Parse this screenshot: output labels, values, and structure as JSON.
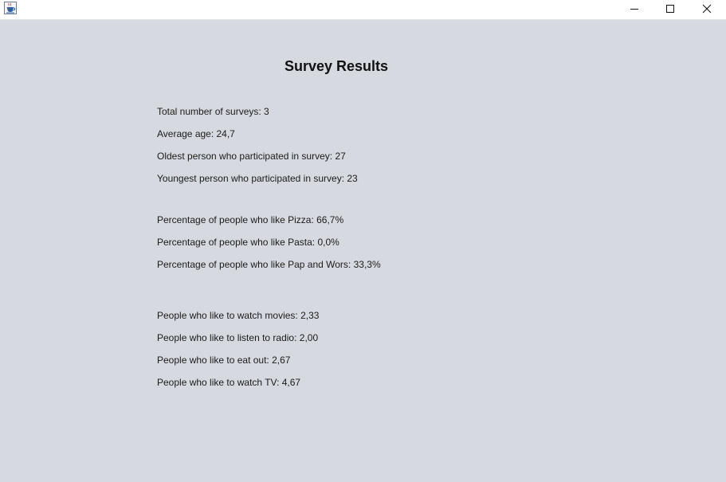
{
  "window": {
    "title": ""
  },
  "survey": {
    "heading": "Survey Results",
    "total": "Total number of surveys: 3",
    "average_age": "Average age: 24,7",
    "oldest": "Oldest person who participated in survey: 27",
    "youngest": "Youngest person who participated in survey: 23",
    "pct_pizza": "Percentage of people who like Pizza: 66,7%",
    "pct_pasta": "Percentage of people who like Pasta: 0,0%",
    "pct_pap": "Percentage of people who like Pap and Wors: 33,3%",
    "movies": "People who like to watch movies: 2,33",
    "radio": "People who like to listen to radio: 2,00",
    "eat_out": "People who like to eat out: 2,67",
    "tv": "People who like to watch TV: 4,67"
  },
  "colors": {
    "background": "#d6d9e0",
    "titlebar": "#ffffff",
    "text": "#1b1b1b"
  },
  "icons": {
    "app": "java-coffee-cup-icon",
    "minimize": "minimize-icon",
    "maximize": "maximize-icon",
    "close": "close-icon"
  }
}
